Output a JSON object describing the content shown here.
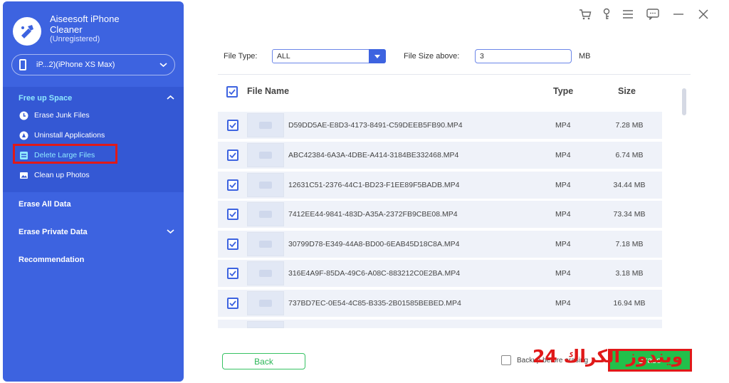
{
  "app": {
    "title": "Aiseesoft iPhone Cleaner",
    "status": "(Unregistered)"
  },
  "device": {
    "name": "iP...2)(iPhone XS Max)"
  },
  "sidebar": {
    "section_title": "Free up Space",
    "items": [
      {
        "label": "Erase Junk Files",
        "icon": "clock-icon"
      },
      {
        "label": "Uninstall Applications",
        "icon": "apps-icon"
      },
      {
        "label": "Delete Large Files",
        "icon": "file-icon",
        "active": true
      },
      {
        "label": "Clean up Photos",
        "icon": "photo-icon"
      }
    ],
    "menus": [
      {
        "label": "Erase All Data"
      },
      {
        "label": "Erase Private Data",
        "expandable": true
      },
      {
        "label": "Recommendation"
      }
    ]
  },
  "window_controls": [
    "cart-icon",
    "key-icon",
    "menu-icon",
    "feedback-icon",
    "minimize-icon",
    "close-icon"
  ],
  "filters": {
    "file_type_label": "File Type:",
    "file_type_value": "ALL",
    "file_size_label": "File Size above:",
    "file_size_value": "3",
    "file_size_unit": "MB"
  },
  "table": {
    "headers": {
      "name": "File Name",
      "type": "Type",
      "size": "Size"
    },
    "rows": [
      {
        "name": "D59DD5AE-E8D3-4173-8491-C59DEEB5FB90.MP4",
        "type": "MP4",
        "size": "7.28 MB",
        "checked": true
      },
      {
        "name": "ABC42384-6A3A-4DBE-A414-3184BE332468.MP4",
        "type": "MP4",
        "size": "6.74 MB",
        "checked": true
      },
      {
        "name": "12631C51-2376-44C1-BD23-F1EE89F5BADB.MP4",
        "type": "MP4",
        "size": "34.44 MB",
        "checked": true
      },
      {
        "name": "7412EE44-9841-483D-A35A-2372FB9CBE08.MP4",
        "type": "MP4",
        "size": "73.34 MB",
        "checked": true
      },
      {
        "name": "30799D78-E349-44A8-BD00-6EAB45D18C8A.MP4",
        "type": "MP4",
        "size": "7.18 MB",
        "checked": true
      },
      {
        "name": "316E4A9F-85DA-49C6-A08C-883212C0E2BA.MP4",
        "type": "MP4",
        "size": "3.18 MB",
        "checked": true
      },
      {
        "name": "737BD7EC-0E54-4C85-B335-2B01585BEBED.MP4",
        "type": "MP4",
        "size": "16.94 MB",
        "checked": true
      }
    ]
  },
  "footer": {
    "back_label": "Back",
    "backup_label": "Backup before erasing",
    "erase_label": "Erase"
  },
  "watermark": "ويندوز الكراك 24",
  "colors": {
    "sidebar": "#3d63e0",
    "accent": "#3d63e0",
    "highlight": "#8fe9ff",
    "green": "#22c04b",
    "annotation_red": "#e01919"
  }
}
